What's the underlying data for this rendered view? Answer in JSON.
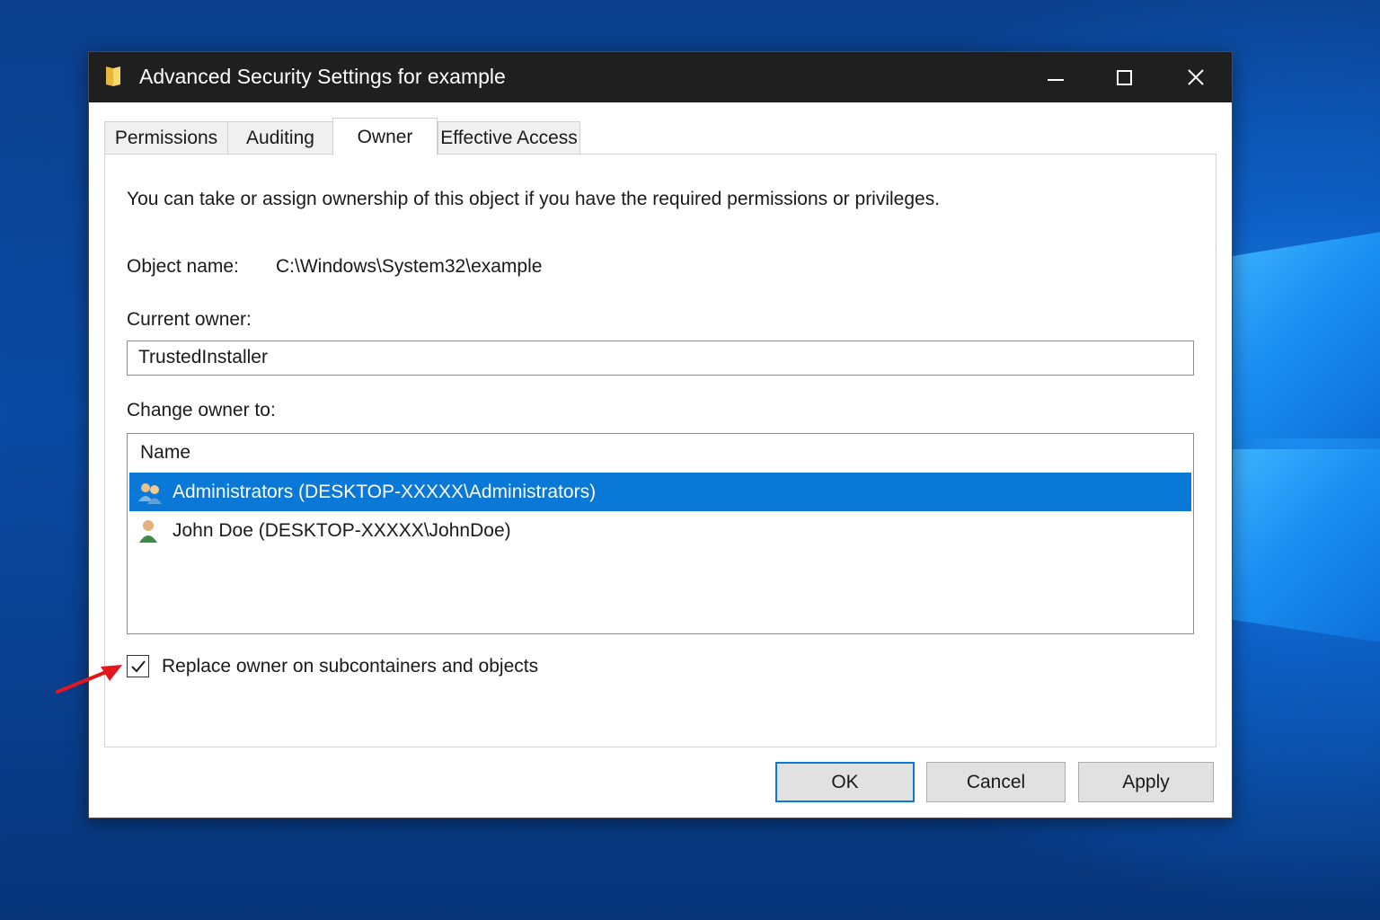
{
  "window": {
    "title": "Advanced Security Settings for example"
  },
  "tabs": [
    {
      "label": "Permissions"
    },
    {
      "label": "Auditing"
    },
    {
      "label": "Owner"
    },
    {
      "label": "Effective Access"
    }
  ],
  "active_tab": "Owner",
  "owner_panel": {
    "description": "You can take or assign ownership of this object if you have the required permissions or privileges.",
    "object_name_label": "Object name:",
    "object_name_value": "C:\\Windows\\System32\\example",
    "current_owner_label": "Current owner:",
    "current_owner_value": "TrustedInstaller",
    "change_owner_label": "Change owner to:",
    "list_header": "Name",
    "list_items": [
      {
        "label": "Administrators (DESKTOP-XXXXX\\Administrators)",
        "icon": "group-users-icon",
        "selected": true
      },
      {
        "label": "John Doe (DESKTOP-XXXXX\\JohnDoe)",
        "icon": "user-icon",
        "selected": false
      }
    ],
    "replace_owner_label": "Replace owner on subcontainers and objects",
    "replace_owner_checked": true
  },
  "buttons": {
    "ok": "OK",
    "cancel": "Cancel",
    "apply": "Apply"
  },
  "colors": {
    "titlebar": "#1f1f1f",
    "selection": "#0a78d7",
    "annotation_arrow": "#e3161d"
  }
}
